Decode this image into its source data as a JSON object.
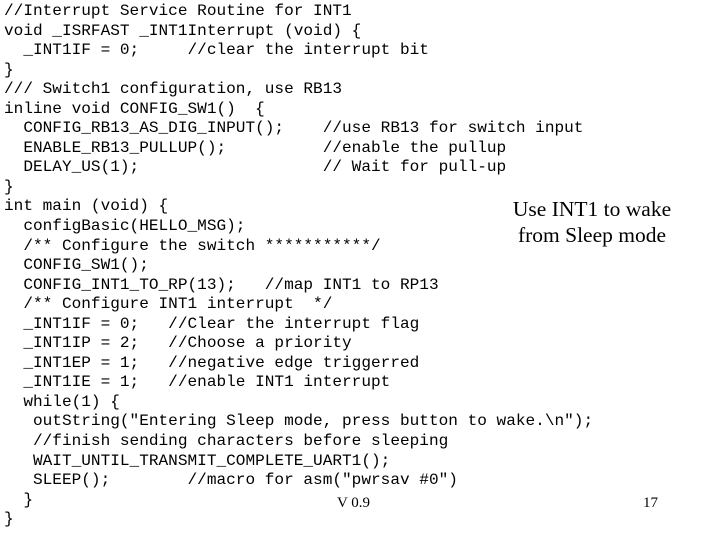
{
  "slide": {
    "background_color": "#ffffff",
    "text_color": "#000000",
    "code": {
      "language": "c",
      "lines": [
        "//Interrupt Service Routine for INT1",
        "void _ISRFAST _INT1Interrupt (void) {",
        "  _INT1IF = 0;     //clear the interrupt bit",
        "}",
        "/// Switch1 configuration, use RB13",
        "inline void CONFIG_SW1()  {",
        "  CONFIG_RB13_AS_DIG_INPUT();    //use RB13 for switch input",
        "  ENABLE_RB13_PULLUP();          //enable the pullup",
        "  DELAY_US(1);                   // Wait for pull-up",
        "}",
        "int main (void) {",
        "  configBasic(HELLO_MSG);",
        "  /** Configure the switch ***********/",
        "  CONFIG_SW1();",
        "  CONFIG_INT1_TO_RP(13);   //map INT1 to RP13",
        "  /** Configure INT1 interrupt  */",
        "  _INT1IF = 0;   //Clear the interrupt flag",
        "  _INT1IP = 2;   //Choose a priority",
        "  _INT1EP = 1;   //negative edge triggerred",
        "  _INT1IE = 1;   //enable INT1 interrupt",
        "  while(1) {",
        "   outString(\"Entering Sleep mode, press button to wake.\\n\");",
        "   //finish sending characters before sleeping",
        "   WAIT_UNTIL_TRANSMIT_COMPLETE_UART1();",
        "   SLEEP();        //macro for asm(\"pwrsav #0\")",
        "  }",
        "}"
      ]
    },
    "callout": {
      "lines": [
        "Use INT1 to wake",
        "from Sleep mode"
      ]
    },
    "footer": {
      "version": "V 0.9",
      "page_number": "17"
    }
  }
}
